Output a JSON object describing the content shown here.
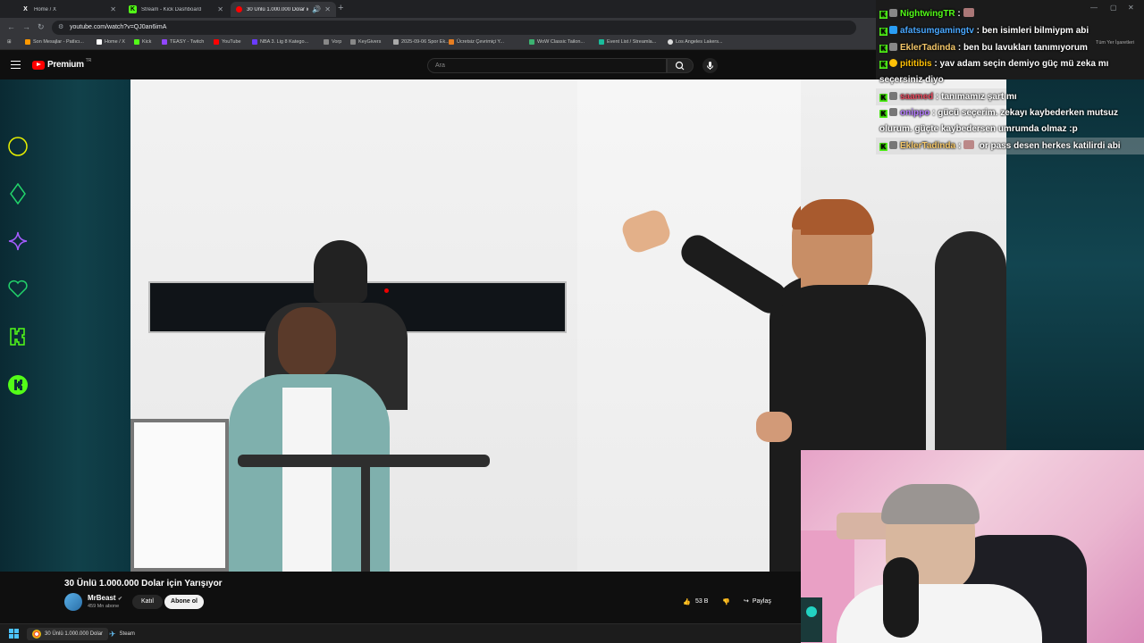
{
  "browser": {
    "tabs": [
      {
        "label": "Home / X"
      },
      {
        "label": "Stream - Kick Dashboard"
      },
      {
        "label": "30 Ünlü 1.000.000 Dolar için"
      }
    ],
    "url": "youtube.com/watch?v=QJ0an6imA",
    "bookmarks": [
      "Son Mesajlar - Patlıcı...",
      "Home / X",
      "Kick",
      "TEASY - Twitch",
      "YouTube",
      "NBA 3. Lig 8 Katego...",
      "Vorp",
      "KeyGivers",
      "2025-09-06 Spor Ek...",
      "Ücretsiz Çevrimiçi Y...",
      "WoW Classic Tailon...",
      "Event List / Streamla...",
      "Los Angeles Lakers..."
    ],
    "bookmarks_right": "Tüm Yer İşaretleri"
  },
  "youtube": {
    "logo_text": "Premium",
    "logo_sup": "TR",
    "search_placeholder": "Ara",
    "video_title": "30 Ünlü 1.000.000 Dolar için Yarışıyor",
    "channel_name": "MrBeast",
    "subscribers": "459 Mn abone",
    "join_label": "Katıl",
    "subscribe_label": "Abone ol",
    "likes": "53 B",
    "share_label": "Paylaş"
  },
  "chat": [
    {
      "user": "NightwingTR",
      "msg": "",
      "user_color": "#53fc18"
    },
    {
      "user": "afatsumgamingtv",
      "msg": "ben isimleri bilmiypm abi",
      "user_color": "#4aa8ff"
    },
    {
      "user": "EklerTadinda",
      "msg": "ben bu lavukları tanımıyorum",
      "user_color": "#f5c86a"
    },
    {
      "user": "pititibis",
      "msg": "yav adam seçin demiyo güç mü zeka mı seçersiniz diyo",
      "user_color": "#ffc107"
    },
    {
      "user": "saamed",
      "msg": "tanımamız şart mı",
      "user_color": "#e84a5f"
    },
    {
      "user": "onippo",
      "msg": "gücü seçerim. zekayı kaybederken mutsuz olurum. güçte kaybedersen umrumda olmaz :p",
      "user_color": "#b57bff"
    },
    {
      "user": "EklerTadinda",
      "msg": "or pass desen herkes katilirdi abi",
      "user_color": "#f5c86a"
    }
  ],
  "taskbar": {
    "items": [
      "30 Ünlü 1.000.000 Dolar",
      "Steam"
    ]
  },
  "colors": {
    "kick_green": "#53fc18",
    "youtube_red": "#ff0000",
    "panel_teal": "#11414a"
  }
}
